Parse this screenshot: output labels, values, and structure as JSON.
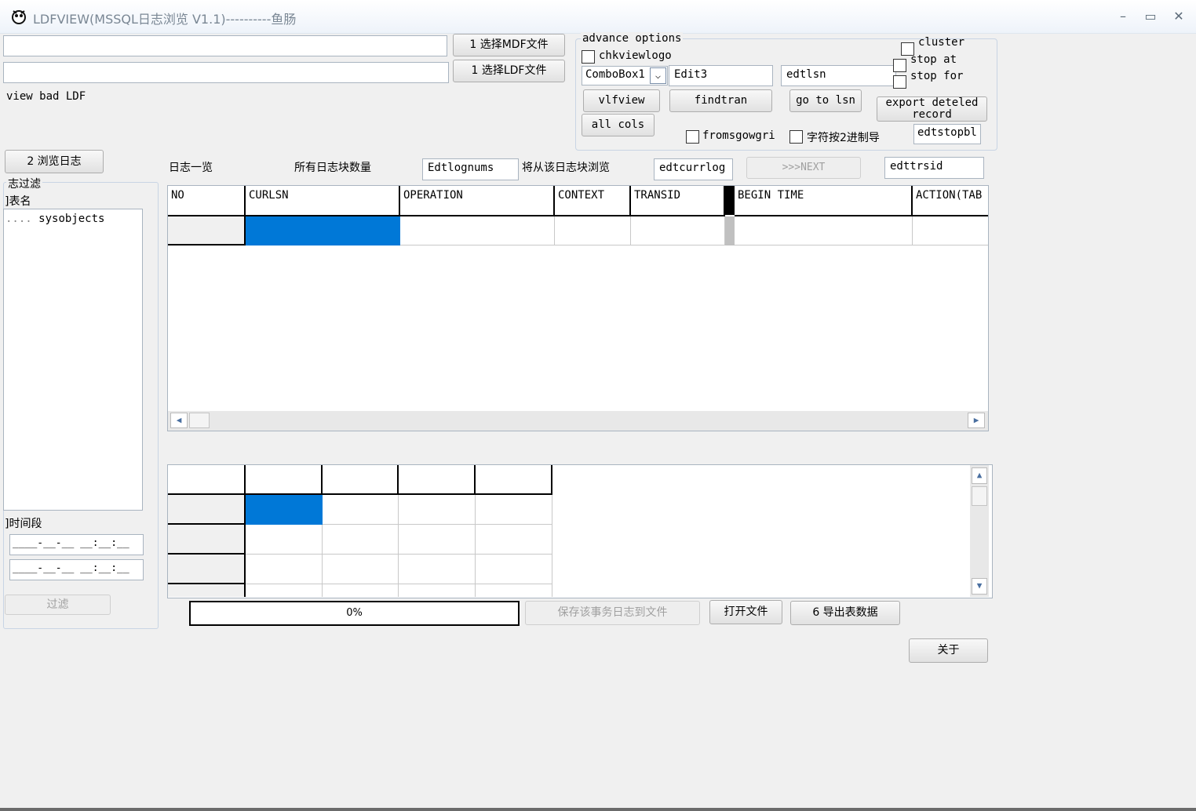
{
  "window": {
    "title": "LDFVIEW(MSSQL日志浏览 V1.1)----------鱼肠",
    "minimize": "–",
    "maximize": "▭",
    "close": "✕"
  },
  "files": {
    "mdf_value": "",
    "ldf_value": "",
    "mdf_button": "1 选择MDF文件",
    "ldf_button": "1 选择LDF文件",
    "view_bad_ldf": "view bad LDF",
    "browse_button": "2 浏览日志"
  },
  "advance": {
    "group_label": "advance options",
    "chkviewlogo": "chkviewlogo",
    "combobox": "ComboBox1",
    "edit3": "Edit3",
    "edtlsn": "edtlsn",
    "cluster": "cluster",
    "stop_at": "stop at",
    "stop_for": "stop for",
    "vlfview": "vlfview",
    "findtran": "findtran",
    "go_to_lsn": "go to lsn",
    "export_deleted": "export deteled record",
    "all_cols": "all cols",
    "fromsgowgri": "fromsgowgri",
    "char_binary": "字符按2进制导",
    "edtstopbl": "edtstopbl"
  },
  "filter": {
    "group_label": "志过滤",
    "table_name_label": "]表名",
    "tree_item": "sysobjects",
    "time_label": "]时间段",
    "time_from": "____-__-__ __:__:__",
    "time_to": "____-__-__ __:__:__",
    "filter_button": "过滤"
  },
  "log_header": {
    "overview": "日志一览",
    "block_count_label": "所有日志块数量",
    "block_count_value": "Edtlognums",
    "browse_from_label": "将从该日志块浏览",
    "curr_log_value": "edtcurrlog",
    "next_button": ">>>NEXT",
    "trsid_value": "edttrsid"
  },
  "log_grid": {
    "columns": [
      "NO",
      "CURLSN",
      "OPERATION",
      "CONTEXT",
      "TRANSID",
      "BEGIN TIME",
      "ACTION(TAB"
    ]
  },
  "bottom": {
    "progress_text": "0%",
    "progress_value": 0,
    "save_button": "保存该事务日志到文件",
    "open_button": "打开文件",
    "export_button": "6 导出表数据",
    "about_button": "关于"
  },
  "colors": {
    "selection": "#0078d7",
    "background": "#f0f0f0"
  }
}
